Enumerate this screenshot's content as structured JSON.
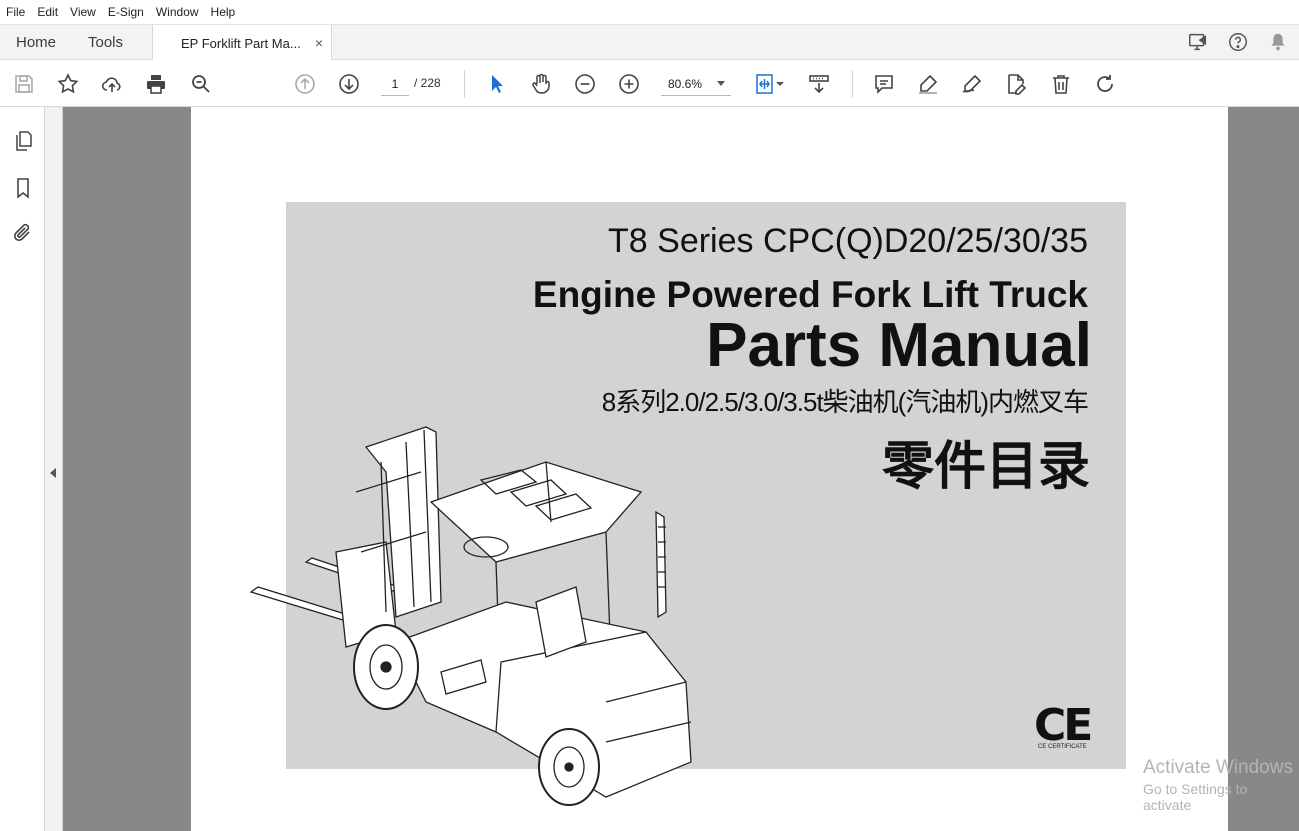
{
  "menu": [
    "File",
    "Edit",
    "View",
    "E-Sign",
    "Window",
    "Help"
  ],
  "tabs": {
    "home": "Home",
    "tools": "Tools",
    "document": "EP Forklift Part Ma...",
    "close": "×"
  },
  "toolbar": {
    "page_current": "1",
    "page_total": "/ 228",
    "zoom": "80.6%"
  },
  "cover": {
    "series": "T8 Series CPC(Q)D20/25/30/35",
    "engine": "Engine Powered Fork Lift Truck",
    "parts": "Parts Manual",
    "cn_line1": "8系列2.0/2.5/3.0/3.5t柴油机(汽油机)内燃叉车",
    "cn_line2": "零件目录",
    "ce": "CE",
    "ce_sub": "CE CERTIFICATE"
  },
  "watermark": {
    "line1": "Activate Windows",
    "line2": "Go to Settings to activate"
  },
  "colors": {
    "cover_bg": "#d1d3d4",
    "doc_bg": "#888888",
    "accent_blue": "#1f6fd6"
  }
}
